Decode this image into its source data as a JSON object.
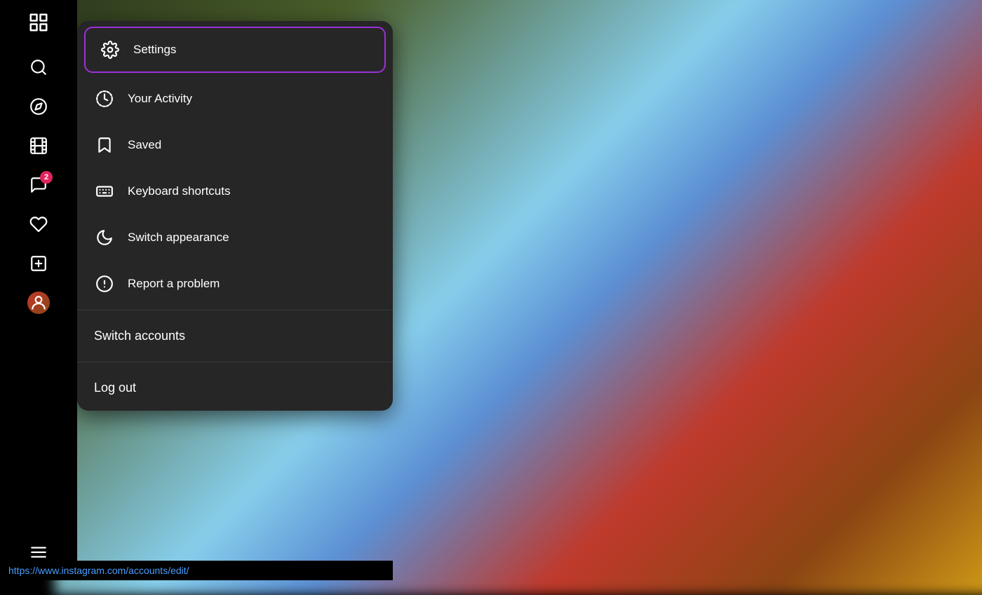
{
  "sidebar": {
    "logo_label": "Instagram",
    "icons": [
      {
        "name": "search",
        "label": "Search"
      },
      {
        "name": "explore",
        "label": "Explore"
      },
      {
        "name": "reels",
        "label": "Reels"
      },
      {
        "name": "messages",
        "label": "Messages",
        "badge": "2"
      },
      {
        "name": "notifications",
        "label": "Notifications"
      },
      {
        "name": "create",
        "label": "Create"
      },
      {
        "name": "profile",
        "label": "Profile"
      },
      {
        "name": "menu",
        "label": "More"
      }
    ]
  },
  "menu": {
    "items": [
      {
        "id": "settings",
        "label": "Settings",
        "icon": "gear",
        "highlighted": true
      },
      {
        "id": "your-activity",
        "label": "Your Activity",
        "icon": "activity"
      },
      {
        "id": "saved",
        "label": "Saved",
        "icon": "bookmark"
      },
      {
        "id": "keyboard-shortcuts",
        "label": "Keyboard shortcuts",
        "icon": "keyboard"
      },
      {
        "id": "switch-appearance",
        "label": "Switch appearance",
        "icon": "moon"
      },
      {
        "id": "report-problem",
        "label": "Report a problem",
        "icon": "alert-circle"
      }
    ],
    "switch_accounts_label": "Switch accounts",
    "logout_label": "Log out"
  },
  "status_bar": {
    "url": "https://www.instagram.com/accounts/edit/"
  },
  "notification_badge": "2"
}
